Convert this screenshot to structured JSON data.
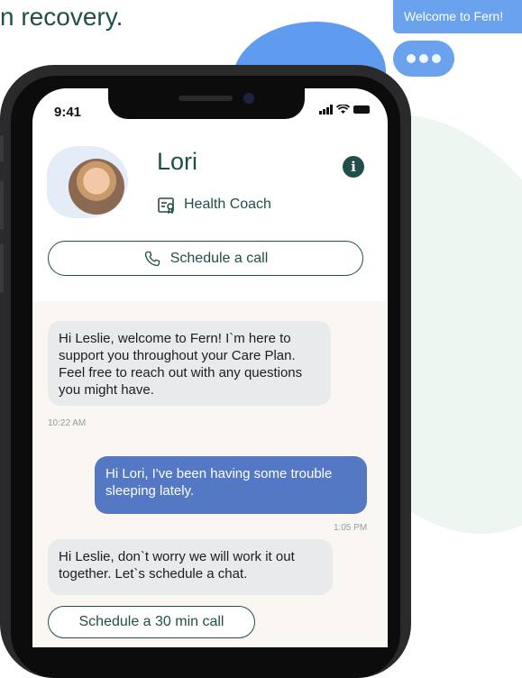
{
  "headline": "n recovery.",
  "welcome_bubble": "Welcome to Fern!",
  "status": {
    "time": "9:41"
  },
  "coach": {
    "name": "Lori",
    "role": "Health Coach"
  },
  "schedule_call_label": "Schedule a call",
  "messages": [
    {
      "from": "coach",
      "text": "Hi Leslie, welcome to Fern! I`m here to support you throughout your Care Plan. Feel free to reach out with any questions you might have.",
      "time": "10:22 AM"
    },
    {
      "from": "user",
      "text": "Hi Lori, I've been having some trouble sleeping lately.",
      "time": "1:05 PM"
    },
    {
      "from": "coach",
      "text": "Hi Leslie, don`t worry we will work it out together. Let`s schedule a chat."
    }
  ],
  "schedule_30_label": "Schedule a 30 min call",
  "icons": {
    "info": "info-icon",
    "badge": "badge-icon",
    "phone": "phone-icon",
    "typing": "typing-dots-icon"
  },
  "colors": {
    "brand_green": "#1f4f48",
    "outgoing_bubble": "#5578c4",
    "accent_blue": "#6aa2ee"
  }
}
